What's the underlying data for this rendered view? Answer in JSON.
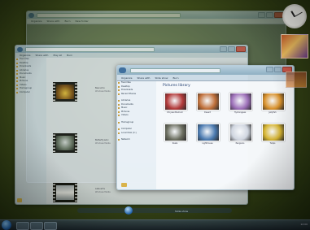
{
  "colors": {
    "desktop": "#3c4a18",
    "glass": "#8fb0c3",
    "accent": "#1d5fa8"
  },
  "window_back": {
    "title": "Documents",
    "toolbar": [
      "Organize",
      "Share with",
      "Burn",
      "New folder"
    ]
  },
  "window_video": {
    "title": "Videos",
    "toolbar": [
      "Organize",
      "Share with",
      "Play all",
      "Burn"
    ],
    "nav": [
      "Favorites",
      "Desktop",
      "Downloads",
      "Libraries",
      "Documents",
      "Music",
      "Pictures",
      "Videos",
      "Homegroup",
      "Computer"
    ],
    "videos": [
      {
        "name": "Bear.wmv",
        "detail": "Windows Media"
      },
      {
        "name": "Butterfly.wmv",
        "detail": "Windows Media"
      },
      {
        "name": "Lake.wmv",
        "detail": "Windows Media"
      }
    ],
    "status": "Items"
  },
  "window_pictures": {
    "title": "Pictures library",
    "heading": "Pictures library",
    "toolbar": [
      "Organize",
      "Share with",
      "Slide show",
      "Burn"
    ],
    "nav": [
      "Favorites",
      "Desktop",
      "Downloads",
      "Recent Places",
      "Libraries",
      "Documents",
      "Music",
      "Pictures",
      "Videos",
      "Homegroup",
      "Computer",
      "Local Disk (C:)",
      "Network"
    ],
    "pictures": [
      {
        "name": "Chrysanthemum",
        "color": "#b23a3a"
      },
      {
        "name": "Desert",
        "color": "#c0703a"
      },
      {
        "name": "Hydrangeas",
        "color": "#9c6fb8"
      },
      {
        "name": "Jellyfish",
        "color": "#d8902a"
      },
      {
        "name": "Koala",
        "color": "#6b6e60"
      },
      {
        "name": "Lighthouse",
        "color": "#4a7ab0"
      },
      {
        "name": "Penguins",
        "color": "#d0d6e0"
      },
      {
        "name": "Tulips",
        "color": "#d6b430"
      }
    ],
    "player": "Slide show"
  },
  "taskbar": {
    "tray_time": "12:00"
  },
  "gadgets": {
    "clock": "clock-gadget",
    "slideshow": "slideshow-gadget"
  }
}
